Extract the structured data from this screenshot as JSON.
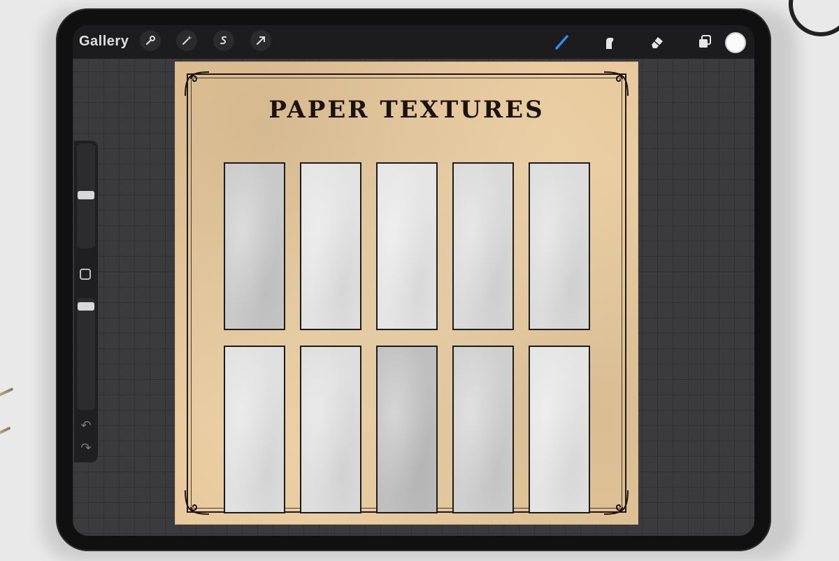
{
  "toolbar": {
    "gallery_label": "Gallery",
    "left_tools": [
      {
        "icon": "wrench-icon",
        "glyph": "🔧"
      },
      {
        "icon": "magic-wand-icon",
        "glyph": "✦"
      },
      {
        "icon": "selection-icon",
        "glyph": "S"
      },
      {
        "icon": "transform-arrow-icon",
        "glyph": "➚"
      }
    ],
    "right_tools": [
      {
        "icon": "brush-icon",
        "active": true
      },
      {
        "icon": "smudge-icon"
      },
      {
        "icon": "eraser-icon"
      },
      {
        "icon": "layers-icon"
      }
    ],
    "current_color": "#fafafa",
    "accent_color": "#2a8ef5"
  },
  "sidebar": {
    "brush_size_level": 0.35,
    "opacity_level": 0.05,
    "undo_icon": "undo-icon",
    "redo_icon": "redo-icon"
  },
  "canvas": {
    "title": "PAPER TEXTURES",
    "background": "#ecd3ab",
    "swatches_top": [
      "#c9c9c9",
      "#e3e3e3",
      "#e5e5e5",
      "#dadada",
      "#dcdcdc"
    ],
    "swatches_bottom": [
      "#e0e0e0",
      "#dedede",
      "#bfbfbf",
      "#cfcfcf",
      "#e4e4e4"
    ]
  }
}
